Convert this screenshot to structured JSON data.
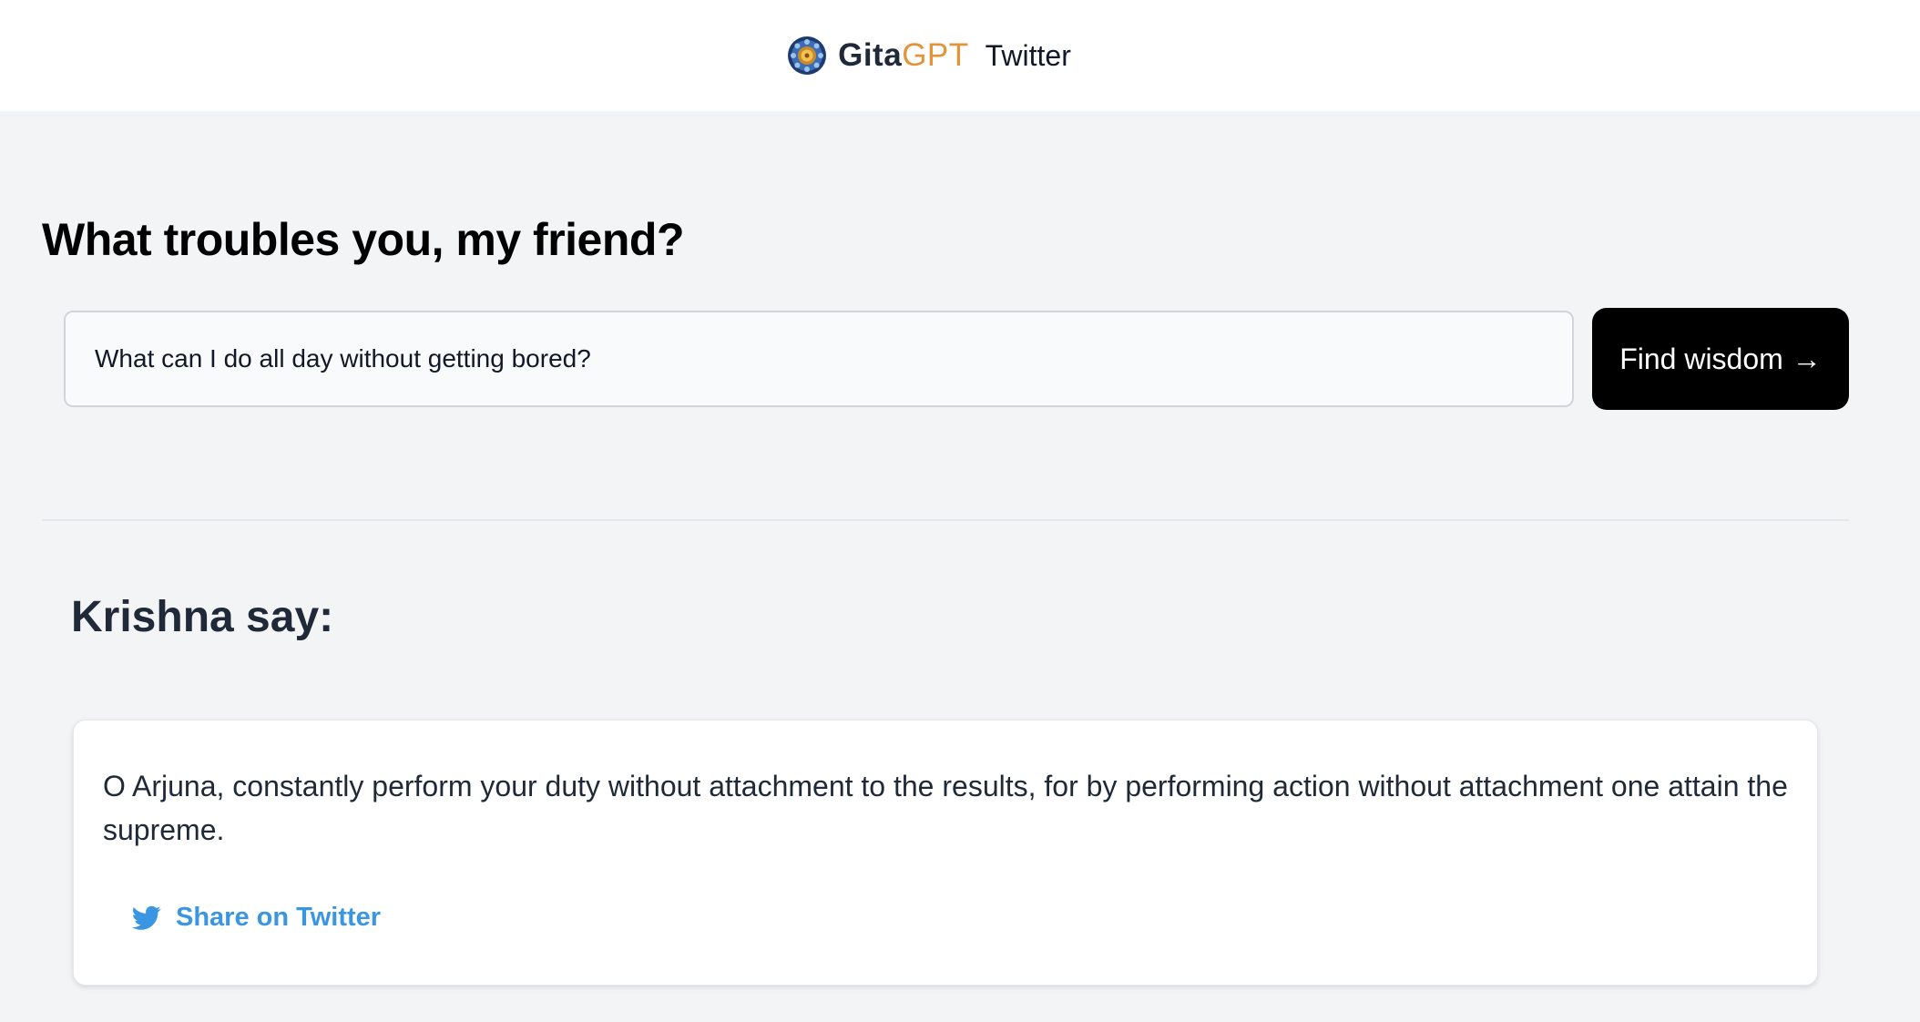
{
  "header": {
    "brand_primary": "Gita",
    "brand_accent": "GPT",
    "twitter_link": "Twitter",
    "logo_icon": "mandala-logo-icon",
    "accent_color": "#e0953a"
  },
  "main": {
    "title": "What troubles you, my friend?",
    "search": {
      "value": "What can I do all day without getting bored?"
    },
    "find_button": {
      "label": "Find wisdom",
      "arrow": "→"
    }
  },
  "response": {
    "title": "Krishna say:",
    "answer": "O Arjuna, constantly perform your duty without attachment to the results, for by performing action without attachment one attain the supreme.",
    "share_label": "Share on Twitter",
    "share_icon": "twitter-bird-icon",
    "share_color": "#3b96e2"
  }
}
